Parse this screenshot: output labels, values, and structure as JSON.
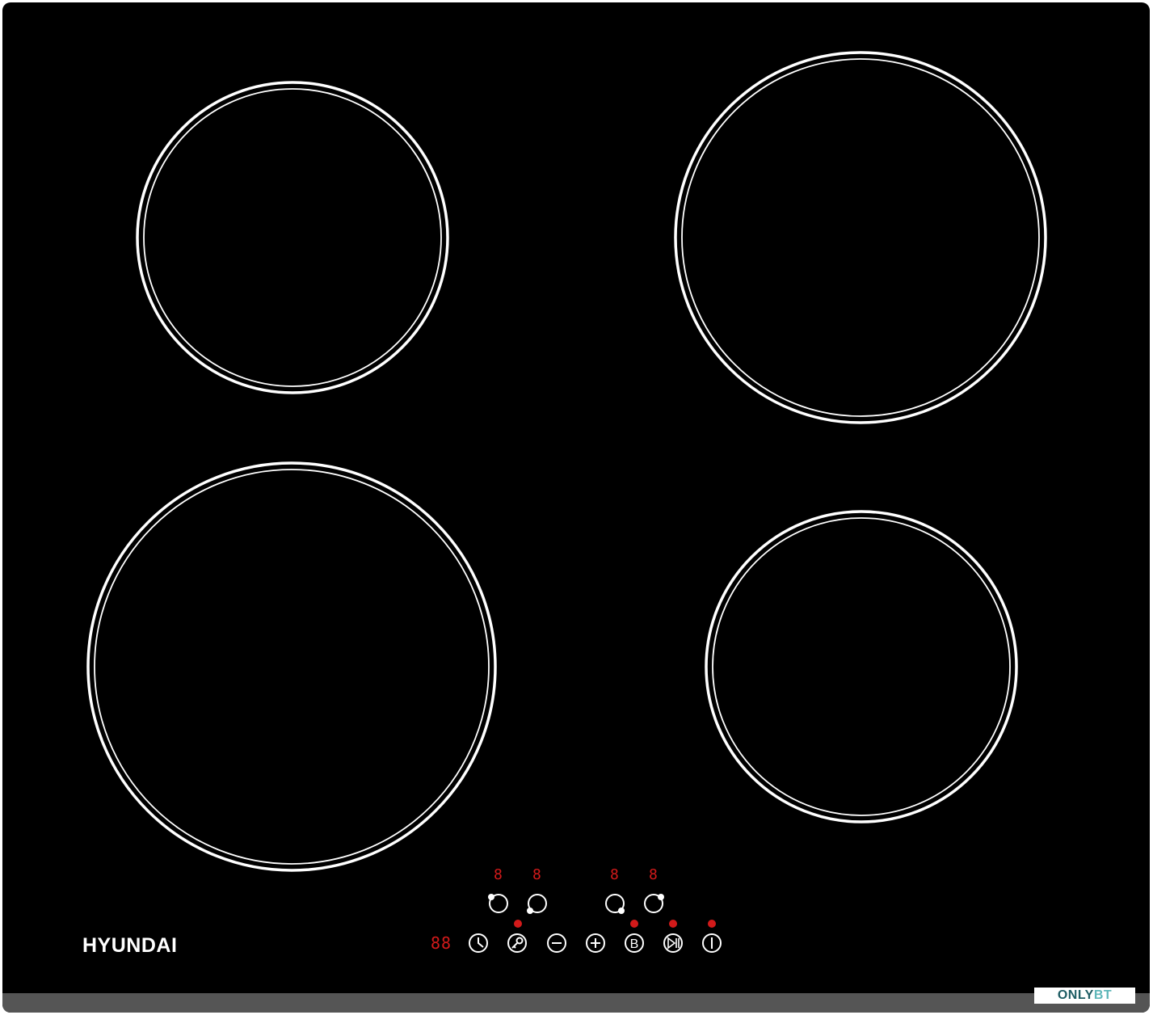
{
  "brand": "HYUNDAI",
  "watermark": {
    "part1": "ONLY",
    "part2": "BT"
  },
  "zone_displays": [
    "8",
    "8",
    "8",
    "8"
  ],
  "timer_display": "88",
  "controls": [
    {
      "name": "timer-icon",
      "indicator": false
    },
    {
      "name": "lock-key-icon",
      "indicator": true
    },
    {
      "name": "minus-icon",
      "indicator": false
    },
    {
      "name": "plus-icon",
      "indicator": false
    },
    {
      "name": "boost-b-icon",
      "indicator": true,
      "glyph": "B"
    },
    {
      "name": "play-pause-icon",
      "indicator": true
    },
    {
      "name": "power-icon",
      "indicator": true
    }
  ],
  "colors": {
    "surface": "#000000",
    "rings": "#ffffff",
    "display": "#d21a1a",
    "strip": "#555555"
  }
}
